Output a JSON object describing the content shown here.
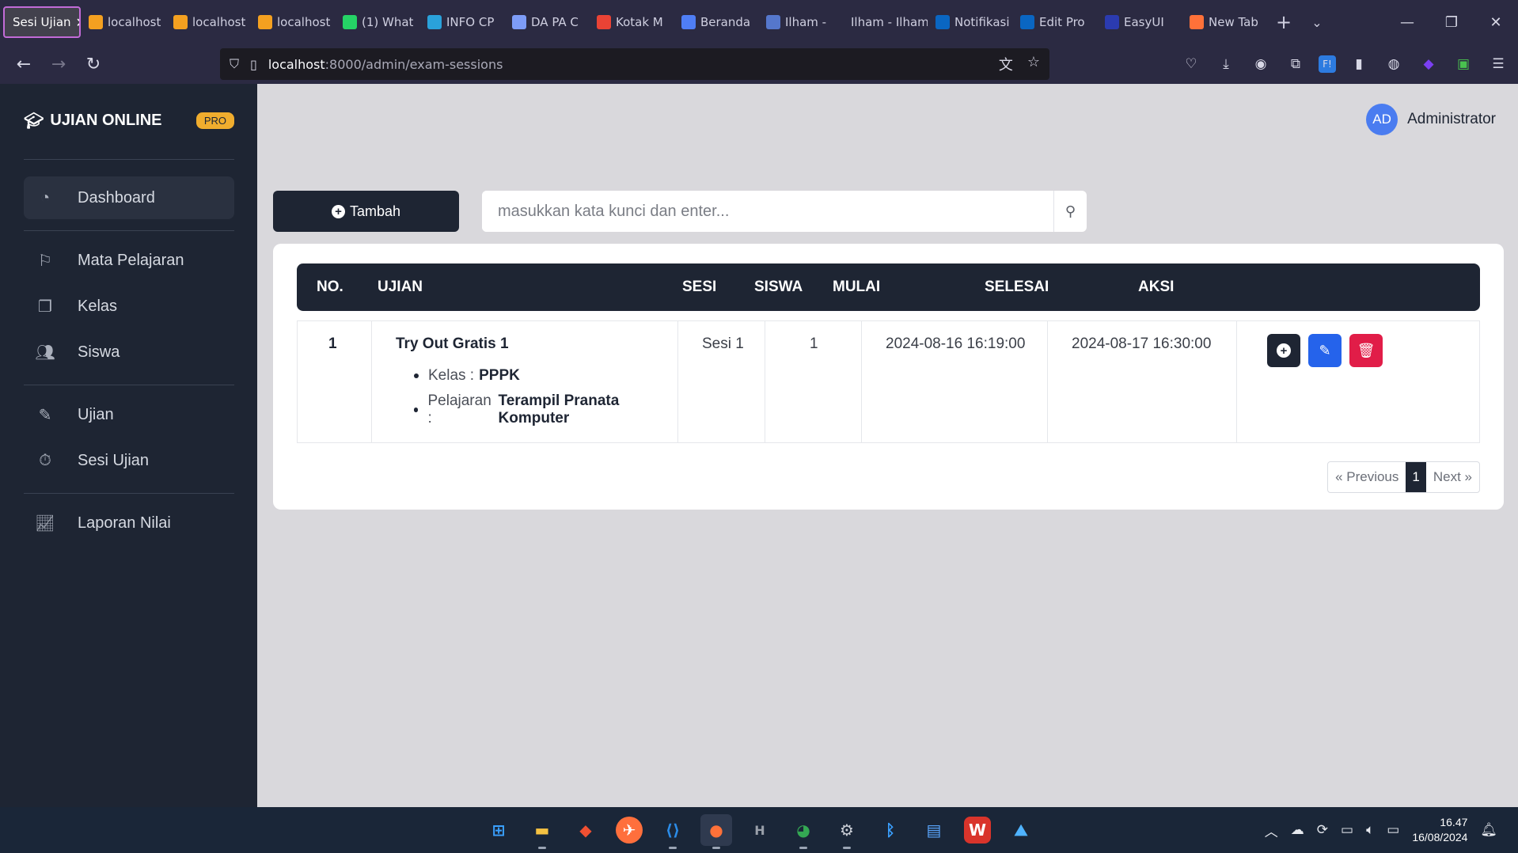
{
  "browser": {
    "tabs": [
      {
        "title": "Sesi Ujian",
        "icon": "page-icon",
        "color": "#42414d"
      },
      {
        "title": "localhost",
        "icon": "laravel-icon",
        "color": "#f4a020"
      },
      {
        "title": "localhost",
        "icon": "laravel-icon",
        "color": "#f4a020"
      },
      {
        "title": "localhost",
        "icon": "laravel-icon",
        "color": "#f4a020"
      },
      {
        "title": "(1) What",
        "icon": "whatsapp-icon",
        "color": "#25d366"
      },
      {
        "title": "INFO CP",
        "icon": "telegram-icon",
        "color": "#2aa1da"
      },
      {
        "title": "DA PA C",
        "icon": "link-icon",
        "color": "#7d9cf7"
      },
      {
        "title": "Kotak M",
        "icon": "gmail-icon",
        "color": "#ea4335"
      },
      {
        "title": "Beranda",
        "icon": "canva-icon",
        "color": "#4f7ef5"
      },
      {
        "title": "Ilham -",
        "icon": "page-icon",
        "color": "#5577cc"
      },
      {
        "title": "Ilham - Ilham",
        "icon": "none",
        "color": "#2b2a42"
      },
      {
        "title": "Notifikasi",
        "icon": "linkedin-icon",
        "color": "#0a66c2"
      },
      {
        "title": "Edit Pro",
        "icon": "linkedin-icon",
        "color": "#0a66c2"
      },
      {
        "title": "EasyUI",
        "icon": "easyui-icon",
        "color": "#2b3bb0"
      },
      {
        "title": "New Tab",
        "icon": "firefox-icon",
        "color": "#ff7139"
      }
    ],
    "url_host": "localhost",
    "url_path": ":8000/admin/exam-sessions"
  },
  "sidebar": {
    "brand": "UJIAN ONLINE",
    "badge": "PRO",
    "items": [
      {
        "label": "Dashboard",
        "icon": "gauge-icon"
      },
      {
        "label": "Mata Pelajaran",
        "icon": "bookmark-icon"
      },
      {
        "label": "Kelas",
        "icon": "copy-icon"
      },
      {
        "label": "Siswa",
        "icon": "users-icon"
      },
      {
        "label": "Ujian",
        "icon": "edit-icon"
      },
      {
        "label": "Sesi Ujian",
        "icon": "stopwatch-icon"
      },
      {
        "label": "Laporan Nilai",
        "icon": "chart-icon"
      }
    ]
  },
  "header": {
    "avatar_initials": "AD",
    "username": "Administrator"
  },
  "toolbar": {
    "add_label": "Tambah",
    "search_placeholder": "masukkan kata kunci dan enter..."
  },
  "table": {
    "columns": [
      "NO.",
      "UJIAN",
      "SESI",
      "SISWA",
      "MULAI",
      "SELESAI",
      "AKSI"
    ],
    "rows": [
      {
        "no": "1",
        "exam": "Try Out Gratis 1",
        "class_label": "Kelas :",
        "class_value": "PPPK",
        "subject_label": "Pelajaran :",
        "subject_value": "Terampil Pranata Komputer",
        "session": "Sesi 1",
        "students": "1",
        "start": "2024-08-16 16:19:00",
        "end": "2024-08-17 16:30:00"
      }
    ]
  },
  "pagination": {
    "previous": "« Previous",
    "current": "1",
    "next": "Next »"
  },
  "taskbar": {
    "time": "16.47",
    "date": "16/08/2024"
  },
  "colors": {
    "sidebar": "#1e2533",
    "primary": "#1e2533",
    "edit": "#2563eb",
    "delete": "#e11d48",
    "badge": "#f0ad2e"
  }
}
